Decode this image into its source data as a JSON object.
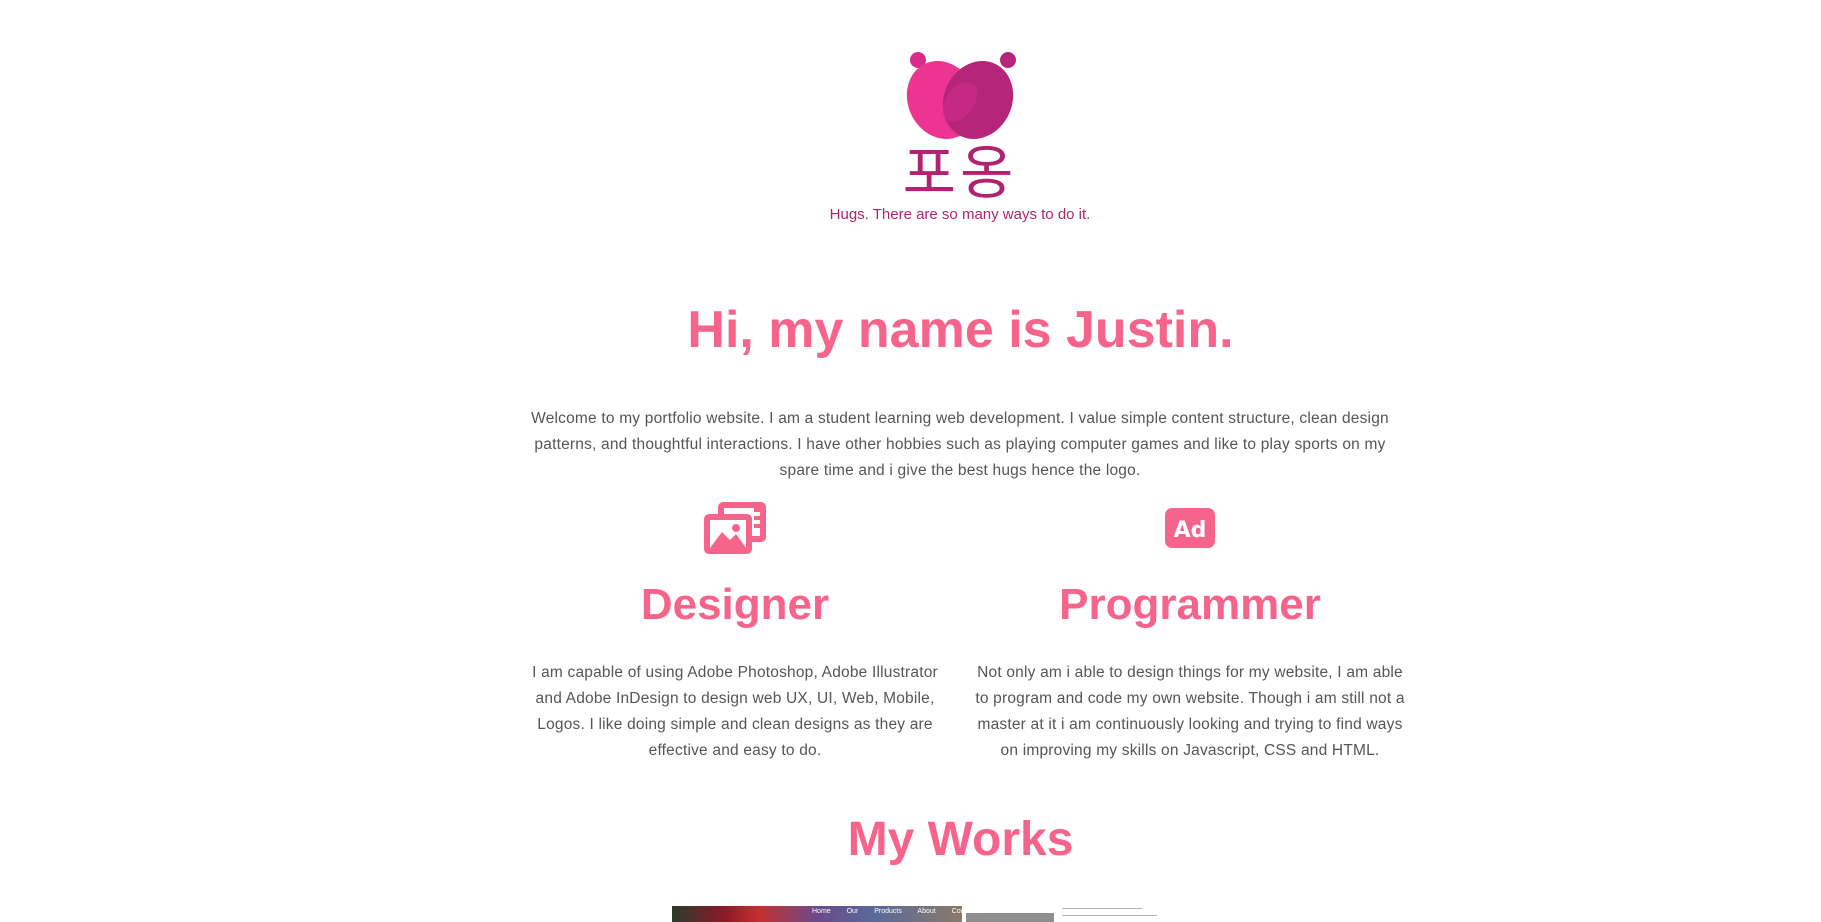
{
  "logo": {
    "hangul": "포옹",
    "tagline": "Hugs. There are so many ways to do it.",
    "colors": {
      "heart_left": "#ec3593",
      "heart_right": "#b5257a",
      "dots": "#d92a8a",
      "text": "#b0246f"
    }
  },
  "hero": {
    "title": "Hi, my name is Justin.",
    "intro": "Welcome to my portfolio website. I am a student learning web development. I value simple content structure, clean design patterns, and thoughtful interactions. I have other hobbies such as playing computer games and like to play sports on my spare time and i give the best hugs hence the logo."
  },
  "skills": [
    {
      "icon": "image-gallery-icon",
      "title": "Designer",
      "text": "I am capable of using Adobe Photoshop, Adobe Illustrator and Adobe InDesign to design web UX, UI, Web, Mobile, Logos. I like doing simple and clean designs as  they are effective and easy to do."
    },
    {
      "icon": "ad-badge-icon",
      "badge_text": "Ad",
      "title": "Programmer",
      "text": "Not only am i able to design things for my website, I am able to program and code my own website. Though i am still not a master at it i am continuously looking and trying to find ways on improving my skills on Javascript, CSS and HTML."
    }
  ],
  "works": {
    "title": "My Works",
    "thumb_nav": "Home Our Products About Contact Us"
  },
  "colors": {
    "accent": "#f7648b",
    "body_text": "#555555",
    "background": "#ffffff"
  }
}
